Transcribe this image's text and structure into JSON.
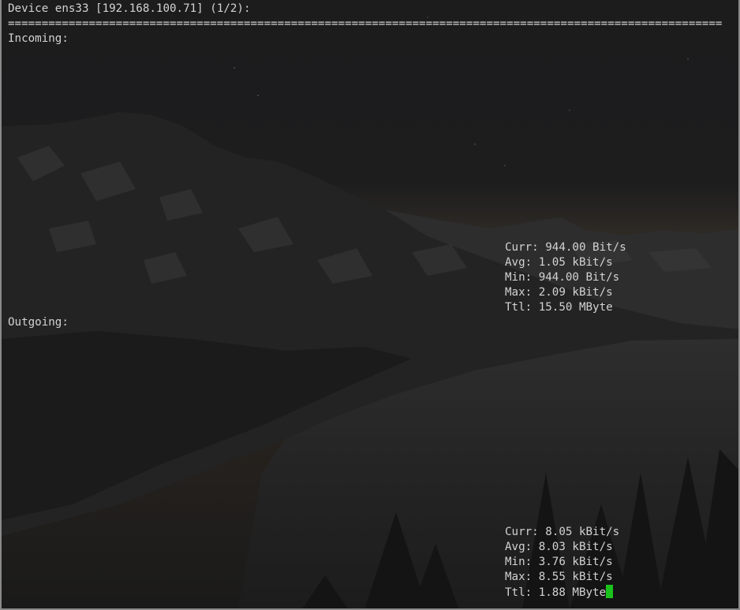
{
  "header": {
    "device_line": "Device ens33 [192.168.100.71] (1/2):",
    "separator": "=========================================================================================================="
  },
  "incoming": {
    "label": "Incoming:",
    "stats": [
      "Curr: 944.00 Bit/s",
      "Avg: 1.05 kBit/s",
      "Min: 944.00 Bit/s",
      "Max: 2.09 kBit/s",
      "Ttl: 15.50 MByte"
    ]
  },
  "outgoing": {
    "label": "Outgoing:",
    "stats": [
      "Curr: 8.05 kBit/s",
      "Avg: 8.03 kBit/s",
      "Min: 3.76 kBit/s",
      "Max: 8.55 kBit/s",
      "Ttl: 1.88 MByte"
    ]
  },
  "colors": {
    "text": "#d3d3d3",
    "cursor": "#1cc21c",
    "background": "#1a1a1a"
  },
  "icons": {
    "cursor": "block-cursor-icon"
  }
}
